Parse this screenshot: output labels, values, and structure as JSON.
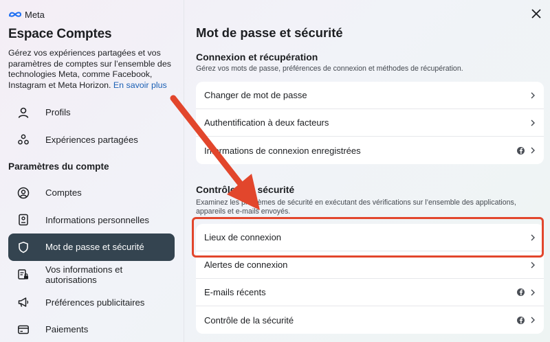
{
  "sidebar": {
    "logo_text": "Meta",
    "title": "Espace Comptes",
    "description": "Gérez vos expériences partagées et vos paramètres de comptes sur l’ensemble des technologies Meta, comme Facebook, Instagram et Meta Horizon.",
    "learn_more": "En savoir plus",
    "items_top": [
      {
        "label": "Profils",
        "icon": "person-icon"
      },
      {
        "label": "Expériences partagées",
        "icon": "shared-experiences-icon"
      }
    ],
    "section_label": "Paramètres du compte",
    "items_bottom": [
      {
        "label": "Comptes",
        "icon": "account-circle-icon"
      },
      {
        "label": "Informations personnelles",
        "icon": "id-card-icon"
      },
      {
        "label": "Mot de passe et sécurité",
        "icon": "shield-icon",
        "active": true
      },
      {
        "label": "Vos informations et autorisations",
        "icon": "info-lock-icon"
      },
      {
        "label": "Préférences publicitaires",
        "icon": "megaphone-icon"
      },
      {
        "label": "Paiements",
        "icon": "credit-card-icon"
      }
    ]
  },
  "main": {
    "title": "Mot de passe et sécurité",
    "login_section": {
      "title": "Connexion et récupération",
      "description": "Gérez vos mots de passe, préférences de connexion et méthodes de récupération.",
      "rows": [
        {
          "label": "Changer de mot de passe",
          "facebook": false
        },
        {
          "label": "Authentification à deux facteurs",
          "facebook": false
        },
        {
          "label": "Informations de connexion enregistrées",
          "facebook": true
        }
      ]
    },
    "security_section": {
      "title": "Contrôles de sécurité",
      "description": "Examinez les problèmes de sécurité en exécutant des vérifications sur l’ensemble des applications, appareils et e-mails envoyés.",
      "rows": [
        {
          "label": "Lieux de connexion",
          "facebook": false
        },
        {
          "label": "Alertes de connexion",
          "facebook": false
        },
        {
          "label": "E-mails récents",
          "facebook": true
        },
        {
          "label": "Contrôle de la sécurité",
          "facebook": true
        }
      ]
    }
  },
  "colors": {
    "active_nav": "#344450",
    "annotation": "#e2462c",
    "link": "#1a5fb4"
  }
}
